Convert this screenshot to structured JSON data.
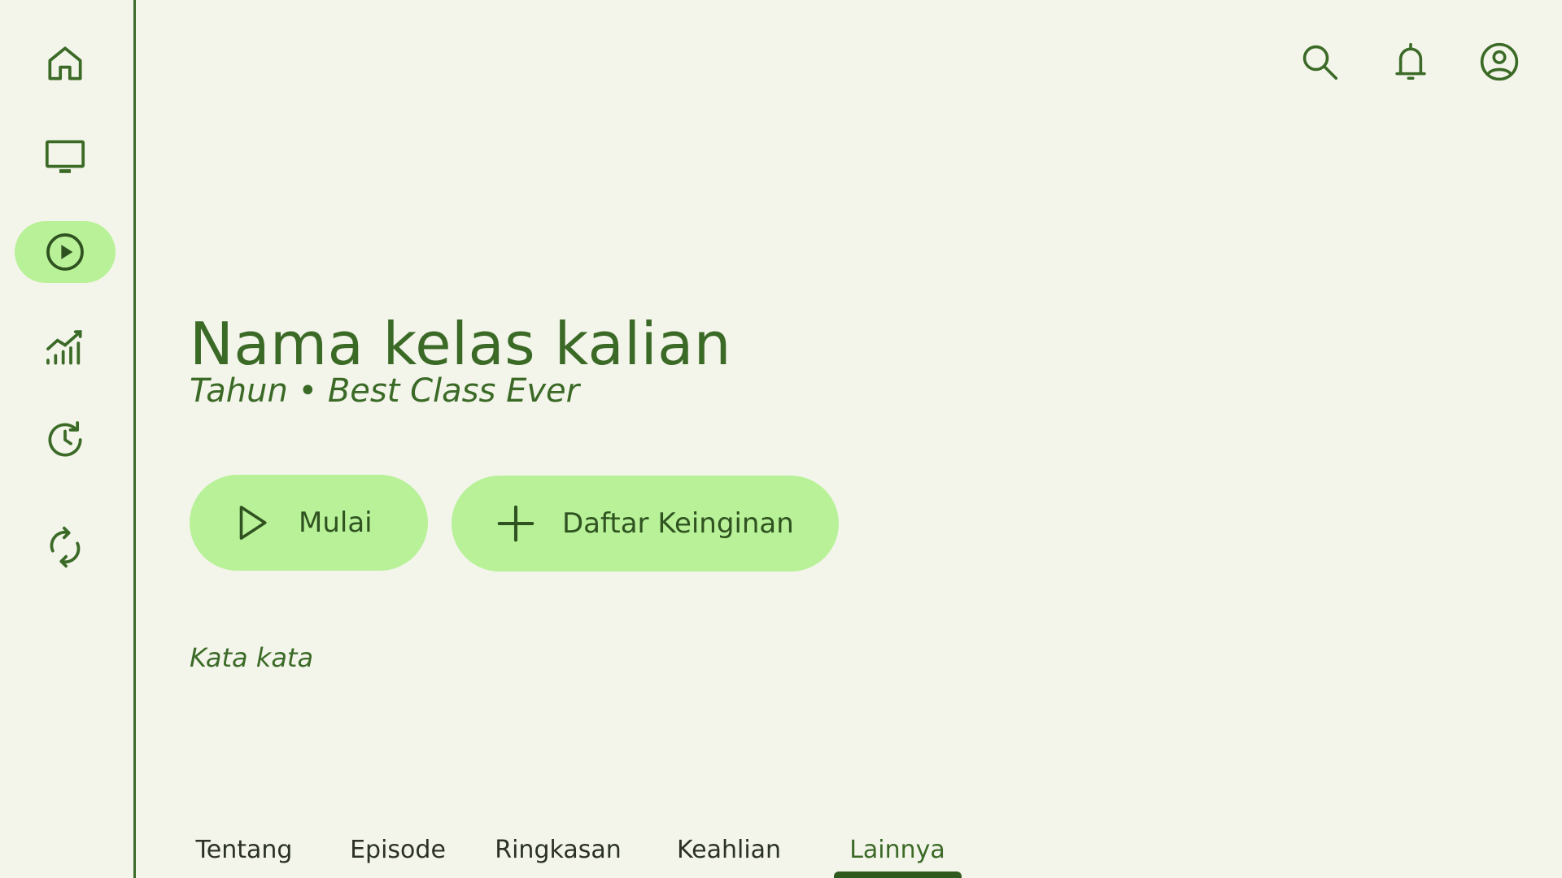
{
  "sidebar": {
    "items": [
      {
        "icon": "home-icon",
        "active": false
      },
      {
        "icon": "tv-icon",
        "active": false
      },
      {
        "icon": "play-circle-icon",
        "active": true
      },
      {
        "icon": "analytics-icon",
        "active": false
      },
      {
        "icon": "history-icon",
        "active": false
      },
      {
        "icon": "sync-icon",
        "active": false
      }
    ]
  },
  "header": {
    "icons": [
      "search-icon",
      "notification-bell-icon",
      "account-circle-icon"
    ]
  },
  "main": {
    "title": "Nama kelas kalian",
    "subtitle": "Tahun • Best Class Ever",
    "start_label": "Mulai",
    "wishlist_label": "Daftar Keinginan",
    "description": "Kata kata"
  },
  "tabs": {
    "items": [
      {
        "label": "Tentang",
        "active": false
      },
      {
        "label": "Episode",
        "active": false
      },
      {
        "label": "Ringkasan",
        "active": false
      },
      {
        "label": "Keahlian",
        "active": false
      },
      {
        "label": "Lainnya",
        "active": true
      }
    ]
  },
  "colors": {
    "background": "#f3f5ea",
    "accent": "#b8f198",
    "primary": "#3b6a27",
    "text": "#2b3126"
  }
}
